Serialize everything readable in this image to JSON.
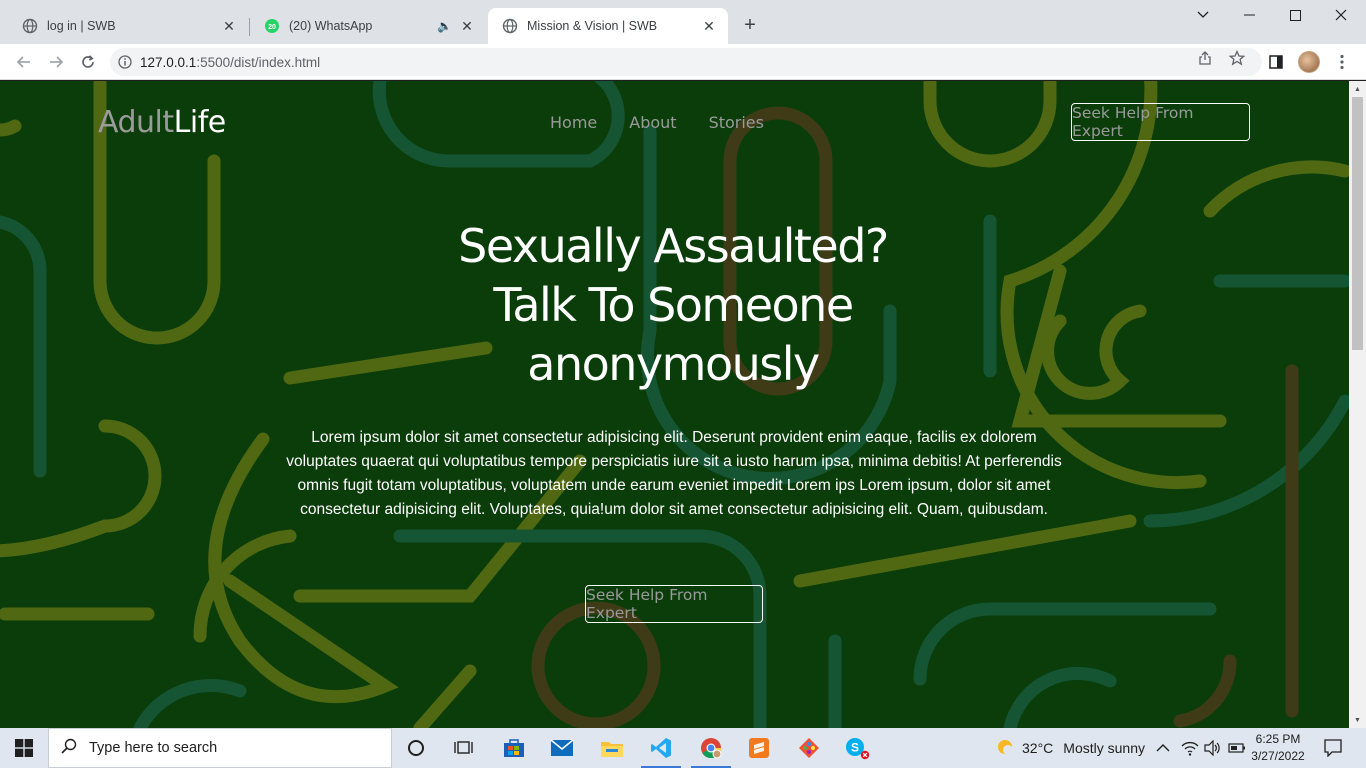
{
  "browser": {
    "tabs": [
      {
        "title": "log in | SWB",
        "active": false
      },
      {
        "title": "(20) WhatsApp",
        "active": false,
        "badge": "20"
      },
      {
        "title": "Mission & Vision | SWB",
        "active": true
      }
    ],
    "url_host": "127.0.0.1",
    "url_rest": ":5500/dist/index.html"
  },
  "page": {
    "brand_part1": "Adult",
    "brand_part2": "Life",
    "nav": [
      "Home",
      "About",
      "Stories"
    ],
    "header_cta": "Seek Help From Expert",
    "hero_line1": "Sexually Assaulted?",
    "hero_line2": "Talk To Someone",
    "hero_line3": "anonymously",
    "hero_text": "Lorem ipsum dolor sit amet consectetur adipisicing elit. Deserunt provident enim eaque, facilis ex dolorem voluptates quaerat qui voluptatibus tempore perspiciatis iure sit a iusto harum ipsa, minima debitis! At perferendis omnis fugit totam voluptatibus, voluptatem unde earum eveniet impedit Lorem ips Lorem ipsum, dolor sit amet consectetur adipisicing elit. Voluptates, quia!um dolor sit amet consectetur adipisicing elit. Quam, quibusdam.",
    "hero_cta": "Seek Help From Expert",
    "colors": {
      "background": "#0a3d0a",
      "accent_yellow": "#6d7a1a",
      "accent_teal": "#1f5a4a",
      "accent_brown": "#5a3a1a"
    }
  },
  "taskbar": {
    "search_placeholder": "Type here to search",
    "weather_temp": "32°C",
    "weather_desc": "Mostly sunny",
    "time": "6:25 PM",
    "date": "3/27/2022"
  }
}
